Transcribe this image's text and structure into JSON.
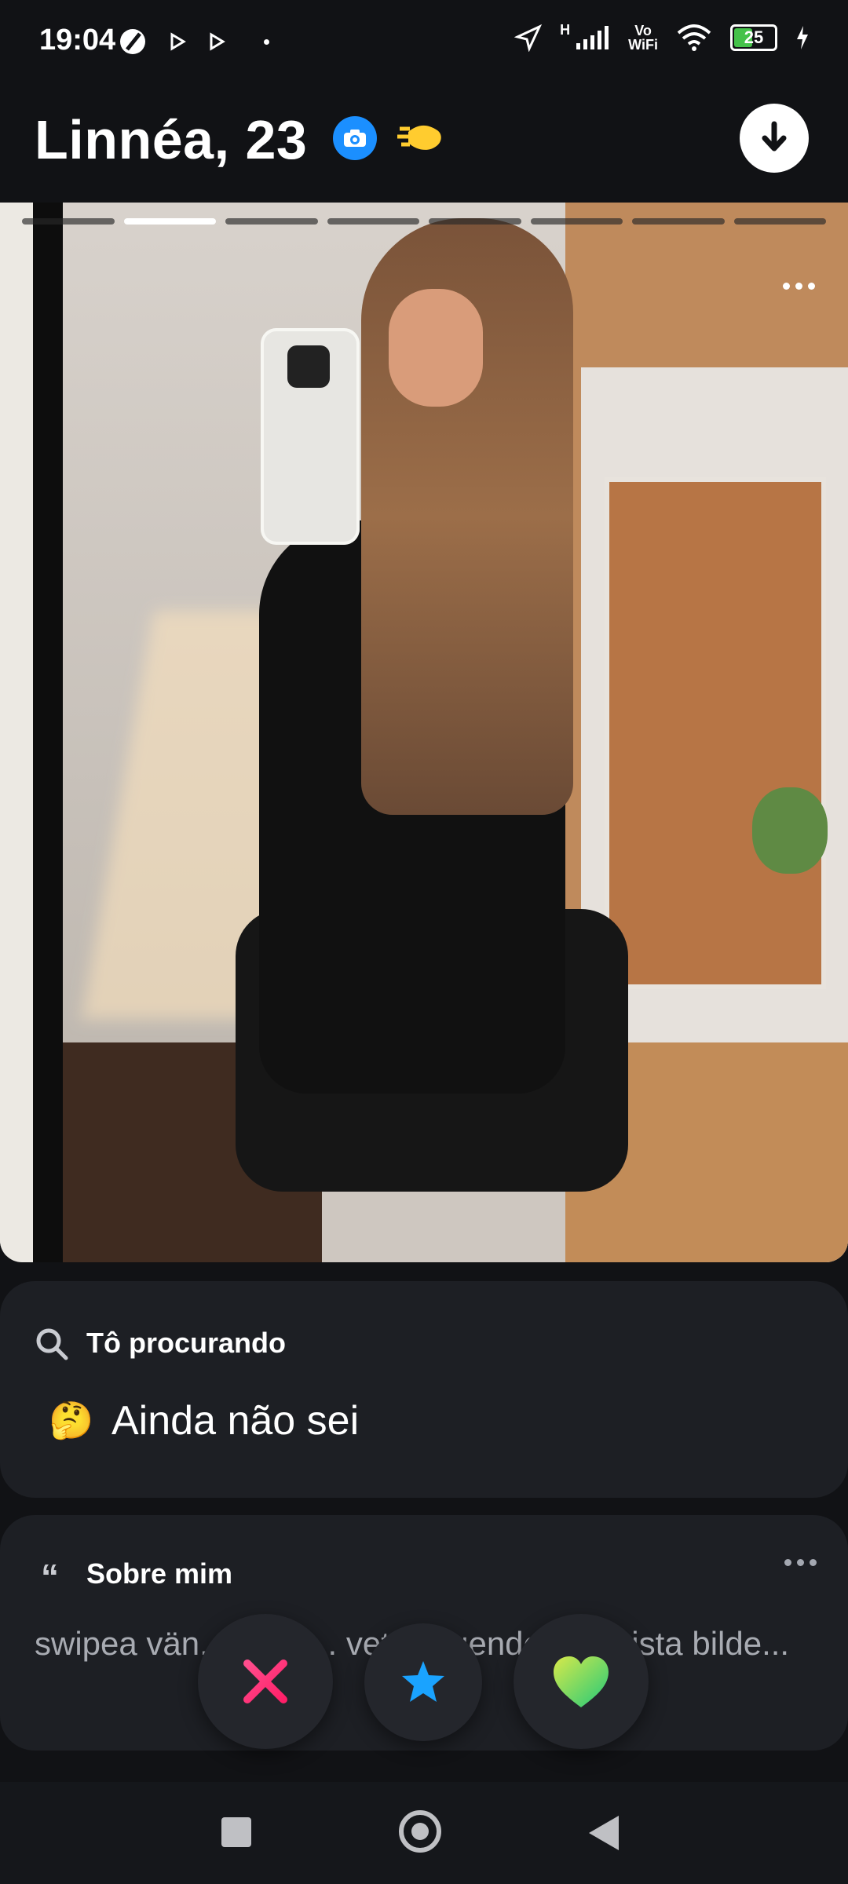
{
  "status_bar": {
    "time": "19:04",
    "network_label": "H",
    "wifi_label_top": "Vo",
    "wifi_label_bottom": "WiFi",
    "battery": "25"
  },
  "profile": {
    "name_age": "Linnéa, 23",
    "verified_icon": "camera-icon",
    "handshake_icon": "handshake-icon",
    "download_icon": "download-icon"
  },
  "photo": {
    "total_photos": 8,
    "active_index": 1
  },
  "looking_for": {
    "title": "Tô procurando",
    "value": "Ainda não sei",
    "emoji": "🤔"
  },
  "about": {
    "title": "Sobre mim",
    "text": "swipea vän... m du... vet v... genden på sista bilde..."
  },
  "actions": {
    "nope_icon": "close-icon",
    "star_icon": "star-icon",
    "like_icon": "heart-icon",
    "accent_pink": "#ff2f79",
    "accent_blue": "#1aa3ff",
    "accent_green": "#61dd5d"
  },
  "system_nav": {
    "recent": "square",
    "home": "circle",
    "back": "triangle"
  }
}
